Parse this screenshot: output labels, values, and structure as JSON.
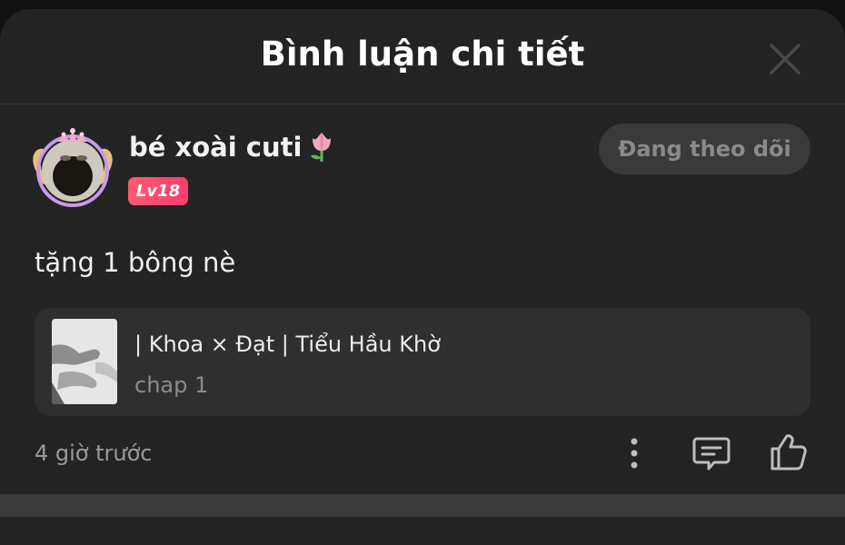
{
  "header": {
    "title": "Bình luận chi tiết",
    "close_icon": "close-icon"
  },
  "comment": {
    "username": "bé xoài cuti",
    "username_emoji_icon": "tulip-icon",
    "level_badge": "Lv18",
    "follow_button": "Đang theo dõi",
    "text": "tặng 1 bông nè",
    "story": {
      "title": "| Khoa × Đạt | Tiểu Hầu Khờ",
      "chapter": "chap 1"
    },
    "time": "4 giờ trước",
    "actions": {
      "more_icon": "more-vertical-icon",
      "reply_icon": "comment-icon",
      "like_icon": "thumbs-up-icon"
    }
  },
  "colors": {
    "background": "#232323",
    "card": "#2f2f2f",
    "level_badge": "#ff4d6d",
    "follow_button_bg": "#3a3a3a",
    "follow_button_text": "#8a8a8a"
  }
}
